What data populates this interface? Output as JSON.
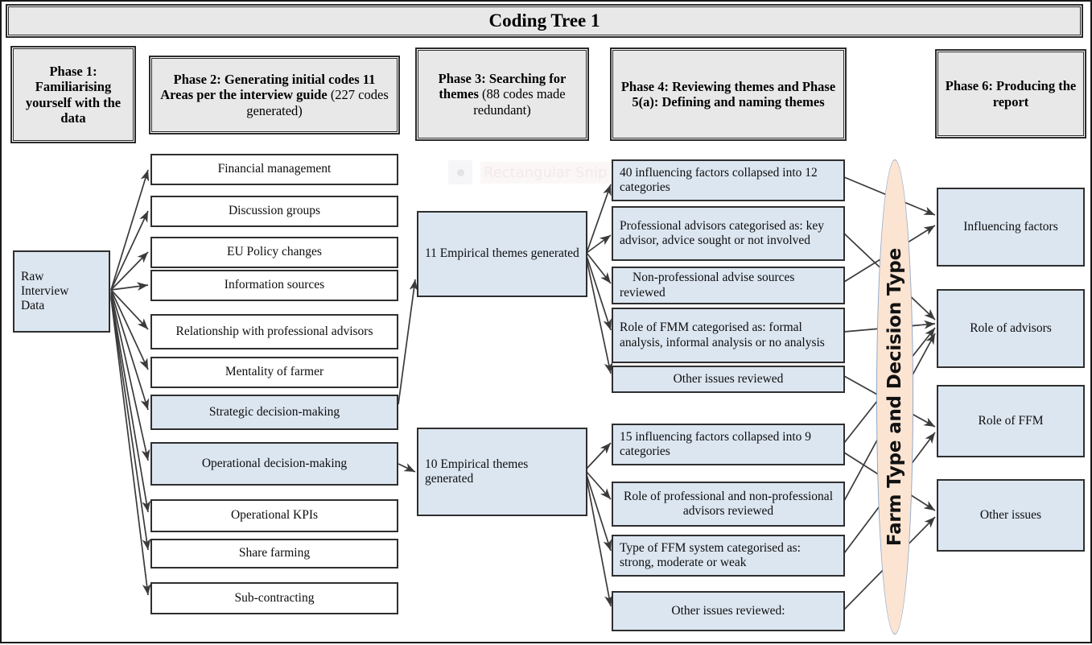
{
  "title": "Coding Tree 1",
  "watermark": {
    "label": "Rectangular Snip",
    "icon": "snip-dot-icon"
  },
  "colors": {
    "blue_fill": "#dce6f1",
    "white_fill": "#ffffff",
    "grey_fill": "#e8e8e8",
    "peach_fill": "#fce4d2",
    "ellipse_stroke": "#8fa8c8",
    "border": "#2f2f2f",
    "arrow": "#3a3a3a"
  },
  "phases": [
    {
      "id": "phase1",
      "line1": "Phase 1:",
      "line2": "Familiarising",
      "line3": "yourself with the",
      "line4": "data"
    },
    {
      "id": "phase2",
      "line1": "Phase 2: Generating initial codes",
      "line2": "11 Areas per the interview guide",
      "line3": "(227 codes generated)"
    },
    {
      "id": "phase3",
      "line1": "Phase 3:",
      "line2": "Searching for themes",
      "line3": "(88 codes made",
      "line4": "redundant)"
    },
    {
      "id": "phase4",
      "line1": "Phase 4: Reviewing themes",
      "line2": "and",
      "line3": "Phase 5(a): Defining and",
      "line4": "naming themes"
    },
    {
      "id": "phase6",
      "line1": "Phase 6:",
      "line2": "Producing the",
      "line3": "report"
    }
  ],
  "source": {
    "label": "Raw Interview Data",
    "line1": "Raw",
    "line2": "Interview",
    "line3": "Data",
    "fill": "blue"
  },
  "interview_areas": [
    {
      "label": "Financial management",
      "fill": "white"
    },
    {
      "label": "Discussion groups",
      "fill": "white"
    },
    {
      "label": "EU Policy changes",
      "fill": "white"
    },
    {
      "label": "Information sources",
      "fill": "white"
    },
    {
      "label": "Relationship with professional advisors",
      "fill": "white"
    },
    {
      "label": "Mentality of farmer",
      "fill": "white"
    },
    {
      "label": "Strategic decision-making",
      "fill": "blue"
    },
    {
      "label": "Operational decision-making",
      "fill": "blue"
    },
    {
      "label": "Operational KPIs",
      "fill": "white"
    },
    {
      "label": "Share farming",
      "fill": "white"
    },
    {
      "label": "Sub-contracting",
      "fill": "white"
    }
  ],
  "theme_groups": [
    {
      "label": "11 Empirical themes generated",
      "fill": "blue"
    },
    {
      "label": "10 Empirical themes generated",
      "fill": "blue"
    }
  ],
  "reviewed_upper": [
    {
      "label": "40 influencing factors collapsed into 12 categories",
      "align": "left",
      "fill": "blue"
    },
    {
      "label": "Professional advisors categorised as: key advisor, advice sought or not involved",
      "align": "left",
      "fill": "blue"
    },
    {
      "label": "Non-professional advise sources reviewed",
      "align": "left-indent",
      "fill": "blue"
    },
    {
      "label": "Role of FMM categorised as: formal analysis, informal analysis or no analysis",
      "align": "left",
      "fill": "blue"
    },
    {
      "label": "Other issues reviewed",
      "align": "center",
      "fill": "blue"
    }
  ],
  "reviewed_lower": [
    {
      "label": "15 influencing factors collapsed into 9 categories",
      "align": "left",
      "fill": "blue"
    },
    {
      "label": "Role of professional and non-professional advisors reviewed",
      "align": "center",
      "fill": "blue"
    },
    {
      "label": "Type of FFM system categorised as: strong, moderate or weak",
      "align": "left",
      "fill": "blue"
    },
    {
      "label": "Other issues reviewed:",
      "align": "center",
      "fill": "blue"
    }
  ],
  "ellipse": {
    "label": "Farm Type and Decision Type"
  },
  "outputs": [
    {
      "label": "Influencing factors",
      "fill": "blue"
    },
    {
      "label": "Role of advisors",
      "fill": "blue"
    },
    {
      "label": "Role of FFM",
      "fill": "blue"
    },
    {
      "label": "Other issues",
      "fill": "blue"
    }
  ]
}
